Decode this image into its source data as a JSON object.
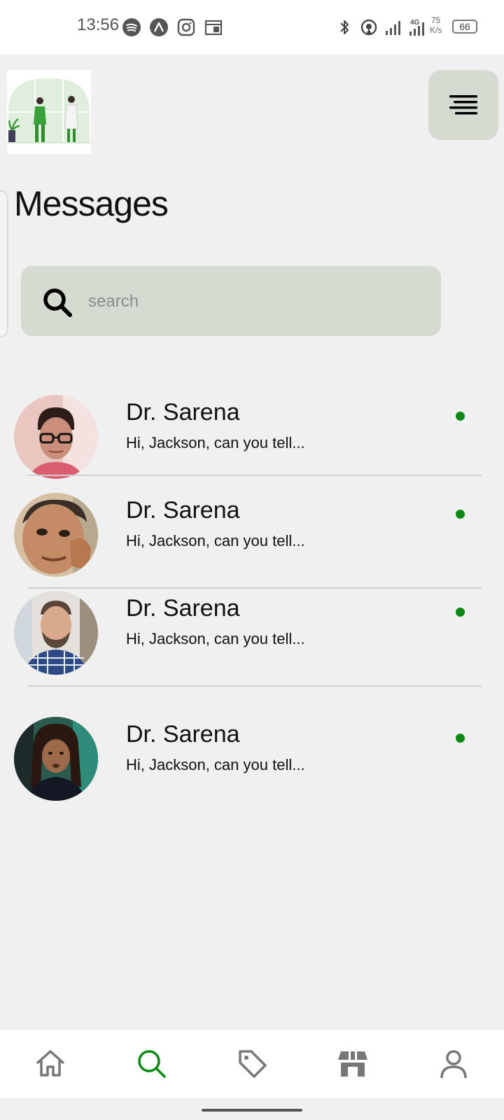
{
  "status_bar": {
    "time": "13:56",
    "network_speed_value": "75",
    "network_speed_unit": "K/s",
    "signal_label": "4G",
    "battery": "66"
  },
  "page": {
    "title": "Messages"
  },
  "search": {
    "placeholder": "search",
    "icon": "search-icon"
  },
  "conversations": [
    {
      "name": "Dr. Sarena",
      "preview": "Hi, Jackson, can you tell...",
      "online": true
    },
    {
      "name": "Dr. Sarena",
      "preview": "Hi, Jackson, can you tell...",
      "online": true
    },
    {
      "name": "Dr. Sarena",
      "preview": "Hi, Jackson, can you tell...",
      "online": true
    },
    {
      "name": "Dr. Sarena",
      "preview": "Hi, Jackson, can you tell...",
      "online": true
    }
  ],
  "bottom_nav": {
    "items": [
      "home-icon",
      "search-icon",
      "tag-icon",
      "store-icon",
      "profile-icon"
    ],
    "active": "search-icon"
  },
  "colors": {
    "accent": "#0a8a12",
    "search_bg": "#d6dbd2",
    "page_bg": "#f0f0f0",
    "online": "#0a8a12"
  }
}
